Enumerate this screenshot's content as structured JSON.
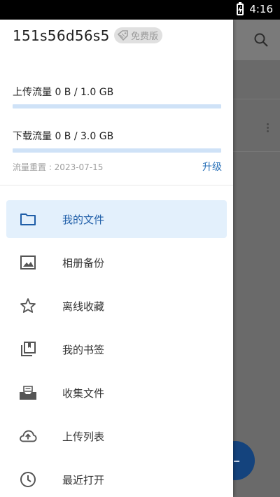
{
  "status": {
    "time": "4:16"
  },
  "drawer": {
    "username": "151s56d56s5",
    "badge": "免费版",
    "upload": {
      "label": "上传流量 0 B / 1.0 GB",
      "fraction": 0.0
    },
    "download": {
      "label": "下载流量 0 B / 3.0 GB",
      "fraction": 0.0
    },
    "reset": "流量重置 : 2023-07-15",
    "upgrade": "升级",
    "menu": [
      {
        "label": "我的文件",
        "icon": "folder-icon",
        "active": true
      },
      {
        "label": "相册备份",
        "icon": "image-icon",
        "active": false
      },
      {
        "label": "离线收藏",
        "icon": "star-icon",
        "active": false
      },
      {
        "label": "我的书签",
        "icon": "bookmark-icon",
        "active": false
      },
      {
        "label": "收集文件",
        "icon": "inbox-icon",
        "active": false
      },
      {
        "label": "上传列表",
        "icon": "cloud-upload-icon",
        "active": false
      },
      {
        "label": "最近打开",
        "icon": "clock-icon",
        "active": false
      }
    ]
  },
  "colors": {
    "accent": "#2a71b8",
    "active_bg": "#e3f0fc",
    "bar_track": "#cfe2f7"
  }
}
